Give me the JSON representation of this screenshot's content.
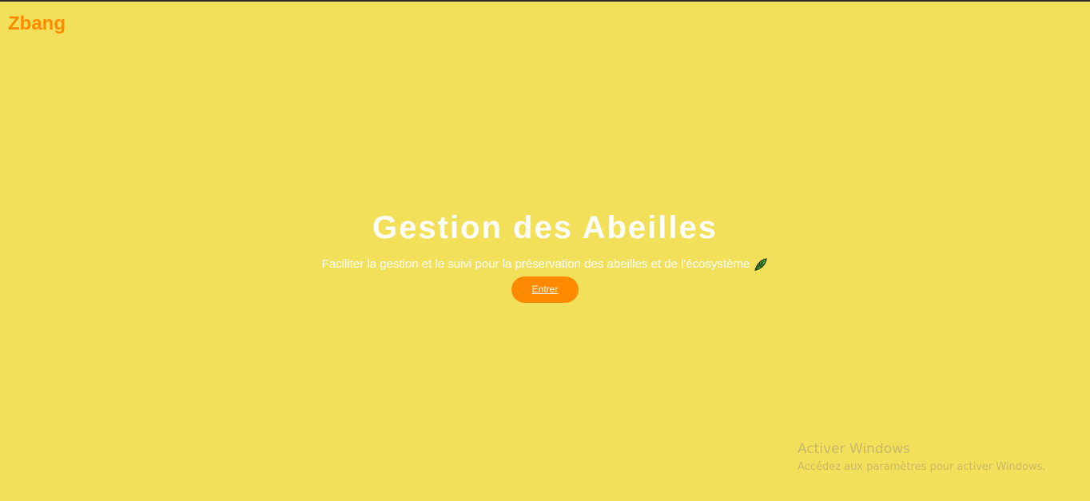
{
  "header": {
    "brand": "Zbang"
  },
  "hero": {
    "title": "Gestion des Abeilles",
    "subtitle": "Faciliter la gestion et le suivi pour la préservation des abeilles et de l'écosystème",
    "subtitle_icon": "leaf-icon",
    "button_label": "Entrer"
  },
  "watermark": {
    "title": "Activer Windows",
    "subtitle": "Accédez aux paramètres pour activer Windows."
  },
  "colors": {
    "background": "#f3e05a",
    "accent": "#ff8a00",
    "text": "#ffffff"
  }
}
